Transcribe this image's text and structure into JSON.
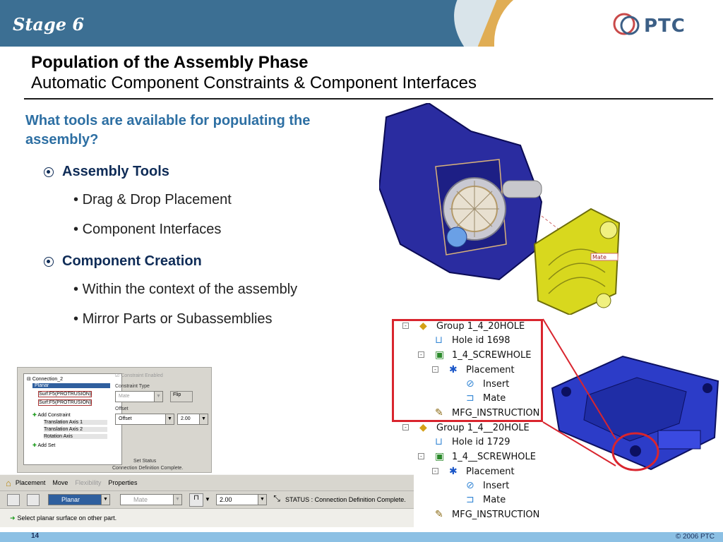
{
  "header": {
    "stage": "Stage 6",
    "logo_text": "PTC",
    "accent_color": "#3c6f93"
  },
  "title": {
    "main": "Population of the Assembly Phase",
    "sub": "Automatic Component Constraints & Component Interfaces"
  },
  "body": {
    "question": "What tools are available for populating the assembly?",
    "sections": [
      {
        "heading": "Assembly Tools",
        "items": [
          "Drag & Drop Placement",
          "Component Interfaces"
        ]
      },
      {
        "heading": "Component Creation",
        "items": [
          "Within the context of the assembly",
          "Mirror Parts or Subassemblies"
        ]
      }
    ]
  },
  "model_tree": {
    "rows": [
      {
        "label": "Group 1_4_20HOLE",
        "icon": "group-icon",
        "expand": "-"
      },
      {
        "label": "Hole id 1698",
        "icon": "hole-icon"
      },
      {
        "label": "1_4_SCREWHOLE",
        "icon": "component-icon",
        "expand": "-"
      },
      {
        "label": "Placement",
        "icon": "placement-icon",
        "expand": "-"
      },
      {
        "label": "Insert",
        "icon": "insert-icon"
      },
      {
        "label": "Mate",
        "icon": "mate-icon"
      },
      {
        "label": "MFG_INSTRUCTION",
        "icon": "note-icon"
      },
      {
        "label": "Group 1_4__20HOLE",
        "icon": "group-icon",
        "expand": "-"
      },
      {
        "label": "Hole id 1729",
        "icon": "hole-icon"
      },
      {
        "label": "1_4__SCREWHOLE",
        "icon": "component-icon",
        "expand": "-"
      },
      {
        "label": "Placement",
        "icon": "placement-icon",
        "expand": "-"
      },
      {
        "label": "Insert",
        "icon": "insert-icon"
      },
      {
        "label": "Mate",
        "icon": "mate-icon"
      },
      {
        "label": "MFG_INSTRUCTION",
        "icon": "note-icon"
      }
    ]
  },
  "constraint_dialog": {
    "tree_items": [
      "Connection_2",
      "Planar",
      "Surf:F5(PROTRUSION)",
      "Surf:F5(PROTRUSION)",
      "Add Constraint",
      "Translation Axis 1",
      "Translation Axis 2",
      "Rotation Axis",
      "Add Set"
    ],
    "constraint_enabled": "Constraint Enabled",
    "constraint_type_label": "Constraint Type",
    "constraint_type_value": "Mate",
    "flip_label": "Flip",
    "offset_label": "Offset",
    "offset_type": "Offset",
    "offset_value": "2.00",
    "set_status_label": "Set Status",
    "set_status_value": "Connection Definition Complete."
  },
  "dashboard": {
    "tabs": [
      "Placement",
      "Move",
      "Flexibility",
      "Properties"
    ],
    "connection_type": "Planar",
    "constraint": "Mate",
    "offset_value": "2.00",
    "status": "STATUS : Connection Definition Complete.",
    "message": "Select planar surface on other part."
  },
  "cad_label": "Mate",
  "footer": {
    "page": "14",
    "copyright": "© 2006 PTC"
  }
}
